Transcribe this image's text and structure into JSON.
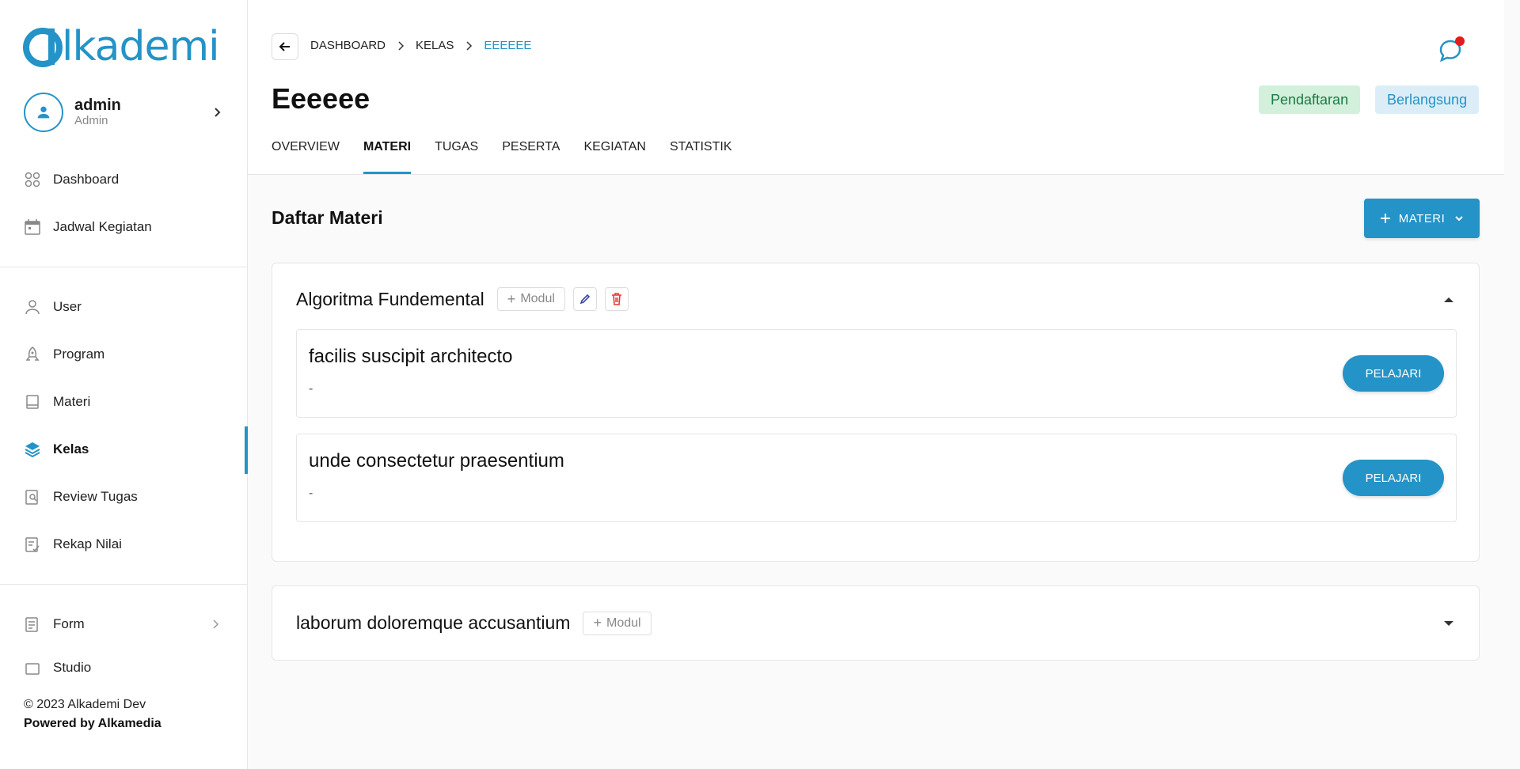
{
  "brand": {
    "name": "lkademi",
    "color": "#2493c7"
  },
  "user": {
    "name": "admin",
    "role": "Admin"
  },
  "sidebar": {
    "group1": [
      {
        "label": "Dashboard",
        "icon": "dashboard-icon"
      },
      {
        "label": "Jadwal Kegiatan",
        "icon": "calendar-icon"
      }
    ],
    "group2": [
      {
        "label": "User",
        "icon": "user-icon"
      },
      {
        "label": "Program",
        "icon": "rocket-icon"
      },
      {
        "label": "Materi",
        "icon": "book-icon"
      },
      {
        "label": "Kelas",
        "icon": "layers-icon",
        "active": true
      },
      {
        "label": "Review Tugas",
        "icon": "review-icon"
      },
      {
        "label": "Rekap Nilai",
        "icon": "grade-icon"
      }
    ],
    "group3": [
      {
        "label": "Form",
        "icon": "form-icon"
      },
      {
        "label": "Studio",
        "icon": "studio-icon"
      }
    ]
  },
  "footer": {
    "copyright": "© 2023 Alkademi Dev",
    "powered": "Powered by Alkamedia"
  },
  "breadcrumb": [
    "DASHBOARD",
    "KELAS",
    "EEEEEE"
  ],
  "page": {
    "title": "Eeeeee",
    "badges": [
      {
        "label": "Pendaftaran",
        "color": "#1c7a43"
      },
      {
        "label": "Berlangsung",
        "color": "#2493c7"
      }
    ],
    "tabs": [
      "OVERVIEW",
      "MATERI",
      "TUGAS",
      "PESERTA",
      "KEGIATAN",
      "STATISTIK"
    ],
    "active_tab": "MATERI"
  },
  "main": {
    "section_title": "Daftar Materi",
    "add_button": "MATERI",
    "modules": [
      {
        "title": "Algoritma Fundemental",
        "add_label": "Modul",
        "expanded": true,
        "items": [
          {
            "title": "facilis suscipit architecto",
            "subtitle": "-",
            "action": "PELAJARI"
          },
          {
            "title": "unde consectetur praesentium",
            "subtitle": "-",
            "action": "PELAJARI"
          }
        ]
      },
      {
        "title": "laborum doloremque accusantium",
        "add_label": "Modul",
        "expanded": false,
        "items": []
      }
    ]
  }
}
